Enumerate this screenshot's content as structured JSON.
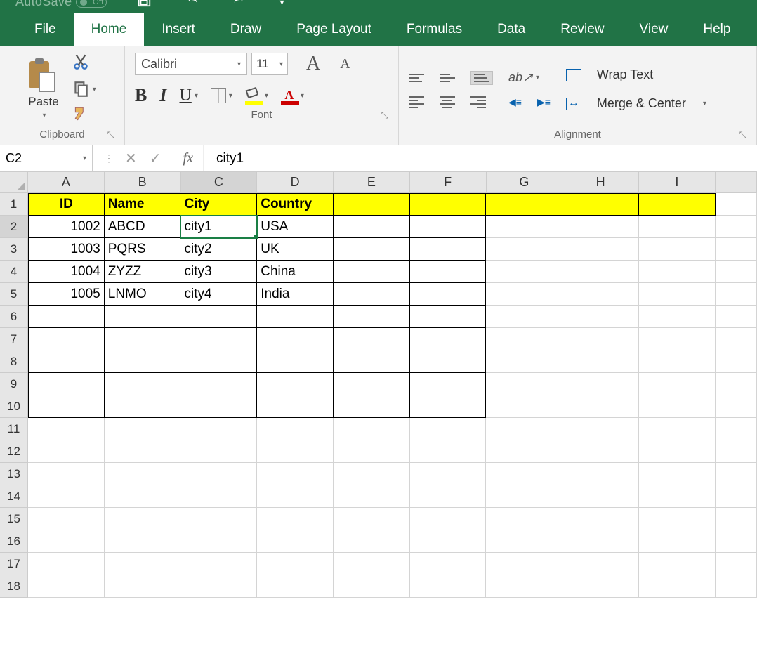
{
  "title": {
    "autosave_label": "AutoSave",
    "autosave_state": "Off"
  },
  "tabs": [
    "File",
    "Home",
    "Insert",
    "Draw",
    "Page Layout",
    "Formulas",
    "Data",
    "Review",
    "View",
    "Help"
  ],
  "active_tab": "Home",
  "ribbon": {
    "clipboard": {
      "paste": "Paste",
      "label": "Clipboard"
    },
    "font": {
      "name": "Calibri",
      "size": "11",
      "label": "Font"
    },
    "alignment": {
      "wrap": "Wrap Text",
      "merge": "Merge & Center",
      "label": "Alignment"
    }
  },
  "formula_bar": {
    "name_box": "C2",
    "fx": "fx",
    "value": "city1"
  },
  "columns": [
    "A",
    "B",
    "C",
    "D",
    "E",
    "F",
    "G",
    "H",
    "I"
  ],
  "selected_col": "C",
  "selected_row": 2,
  "headers": [
    "ID",
    "Name",
    "City",
    "Country"
  ],
  "data_rows": [
    {
      "id": "1002",
      "name": "ABCD",
      "city": "city1",
      "country": "USA"
    },
    {
      "id": "1003",
      "name": "PQRS",
      "city": "city2",
      "country": "UK"
    },
    {
      "id": "1004",
      "name": "ZYZZ",
      "city": "city3",
      "country": "China"
    },
    {
      "id": "1005",
      "name": "LNMO",
      "city": "city4",
      "country": "India"
    }
  ],
  "total_visible_rows": 18
}
